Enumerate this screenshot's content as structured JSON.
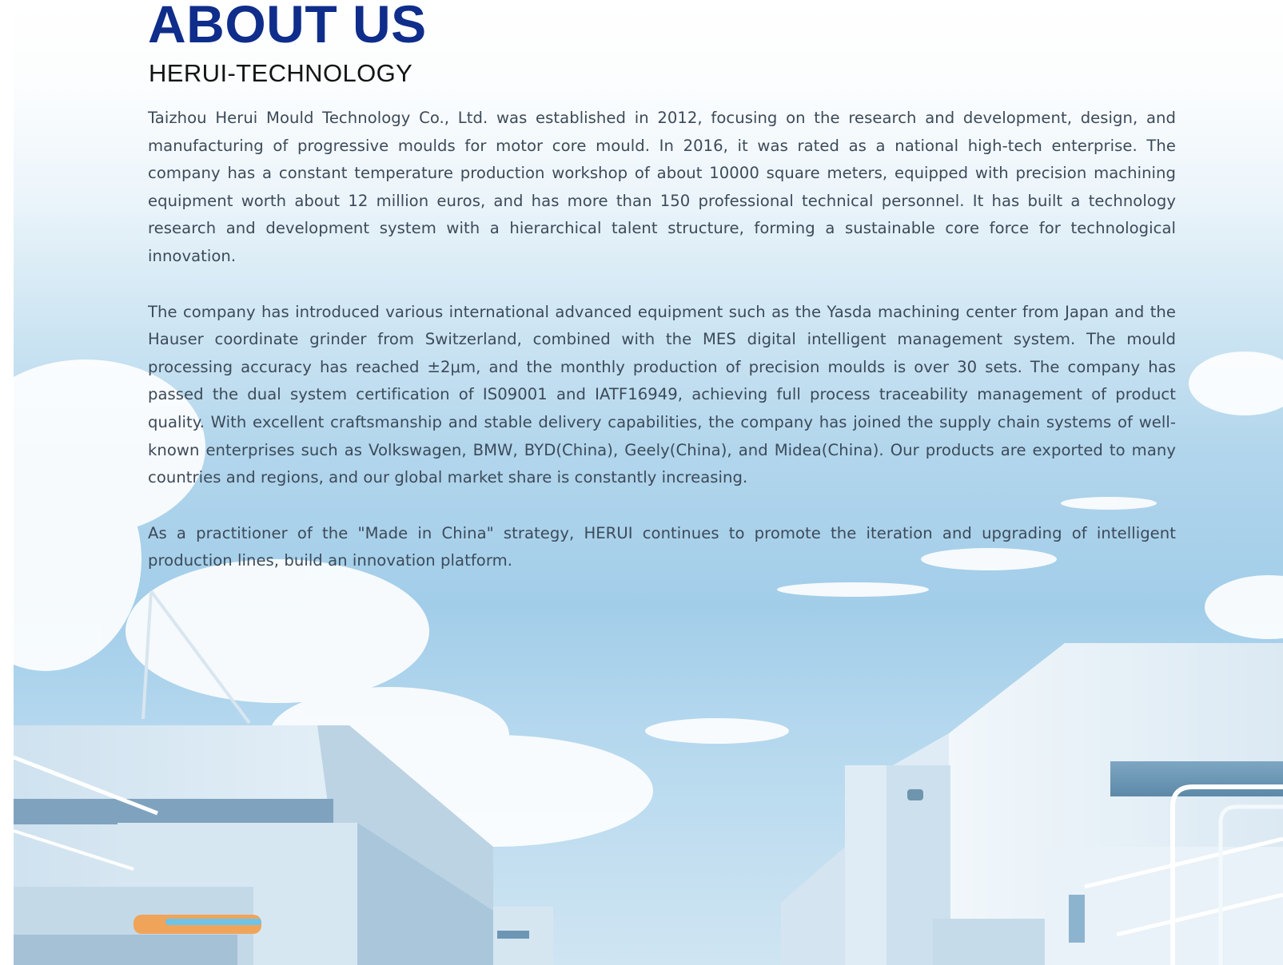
{
  "about": {
    "title": "ABOUT US",
    "subtitle": "HERUI-TECHNOLOGY",
    "paragraphs": [
      "Taizhou Herui Mould Technology Co., Ltd. was established in 2012, focusing on the research and development, design, and manufacturing of progressive moulds for motor core mould. In 2016, it was rated as a national high-tech enterprise. The company has a constant temperature production workshop of about 10000 square meters, equipped with precision machining equipment worth about 12 million euros, and has more than 150 professional technical personnel. It has built a technology research and development system with a hierarchical talent structure, forming a sustainable core force for technological innovation.",
      "The company has introduced various international advanced equipment such as the Yasda machining center from Japan and the Hauser coordinate grinder from Switzerland, combined with the MES digital intelligent management system. The mould processing accuracy has reached ±2μm, and the monthly production of precision moulds is over 30 sets. The company has passed the dual system certification of IS09001 and IATF16949, achieving full process traceability management of product quality. With excellent craftsmanship and stable delivery capabilities, the company has joined the supply chain systems of well-known enterprises such as Volkswagen, BMW, BYD(China), Geely(China), and Midea(China). Our products are exported to many countries and regions, and our global market share is constantly increasing.",
      "As a practitioner of the \"Made in China\" strategy, HERUI continues to promote the iteration and upgrading of intelligent production lines, build an innovation platform."
    ]
  },
  "background": {
    "scene": "factory-buildings-under-sky-illustration",
    "colors": {
      "title": "#0f2d8a",
      "subtitle": "#141414",
      "body_text": "#3c4a59",
      "sky": "#a2cde9"
    }
  }
}
